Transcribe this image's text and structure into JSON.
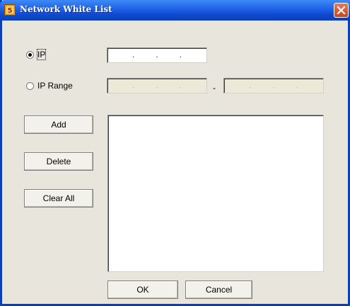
{
  "window": {
    "title": "Network White List",
    "close_icon": "close-icon",
    "app_icon": "app-icon",
    "colors": {
      "titlebar": "#1e60e6",
      "body": "#e8e6dc",
      "close": "#d5522c"
    }
  },
  "mode": {
    "selected": "ip",
    "ip_label": "IP",
    "ip_range_label": "IP Range"
  },
  "ip_field": {
    "dots": [
      ".",
      ".",
      "."
    ]
  },
  "range_from": {
    "dots": [
      ".",
      ".",
      "."
    ]
  },
  "range_separator": "-",
  "range_to": {
    "dots": [
      ".",
      ".",
      "."
    ]
  },
  "buttons": {
    "add": "Add",
    "delete": "Delete",
    "clear_all": "Clear All",
    "ok": "OK",
    "cancel": "Cancel"
  },
  "white_list": {
    "items": []
  }
}
